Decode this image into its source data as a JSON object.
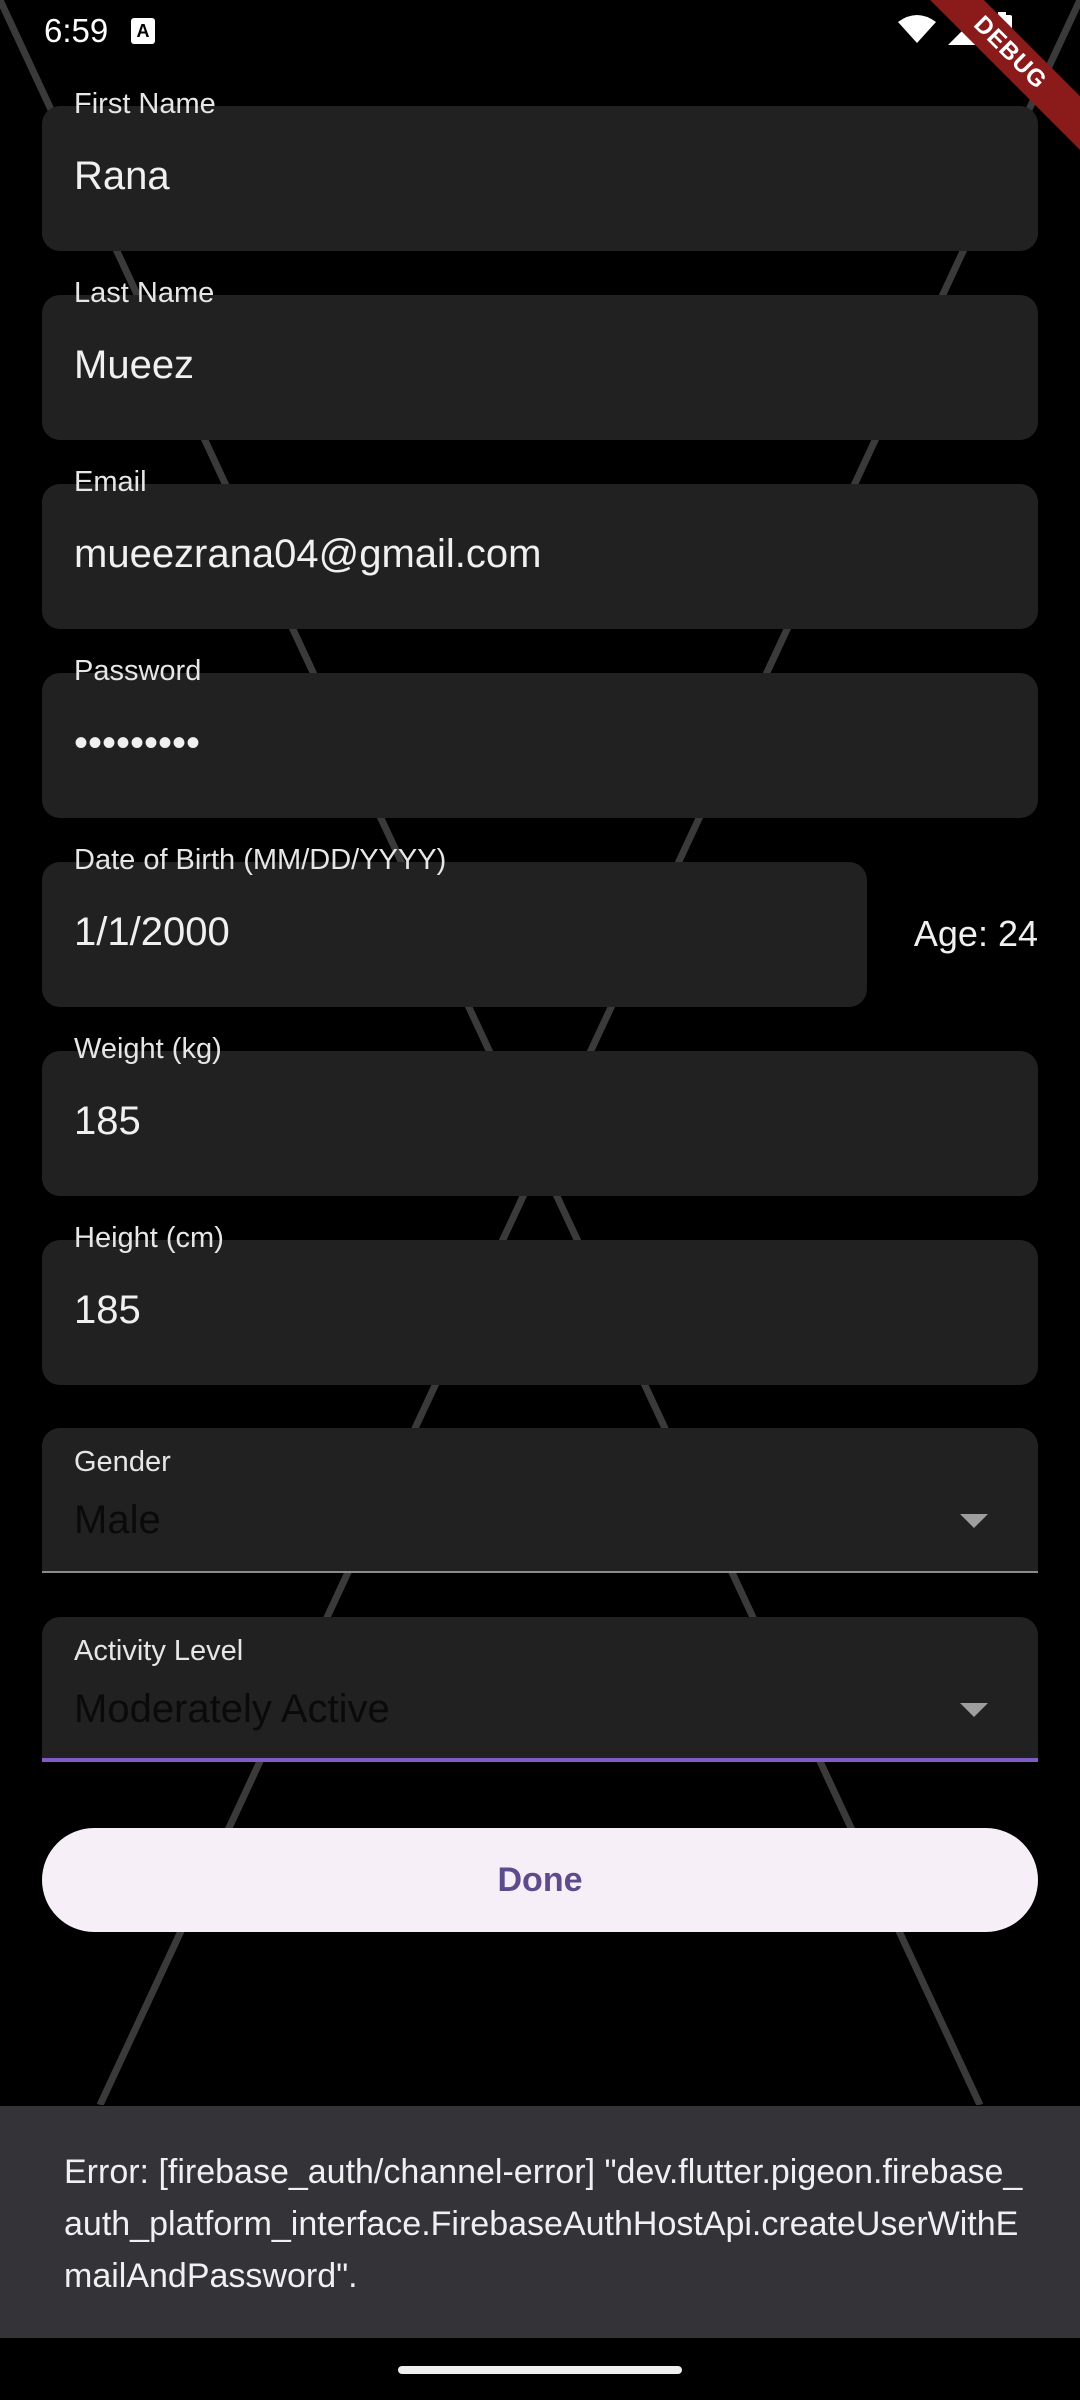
{
  "status_bar": {
    "time": "6:59",
    "notif_glyph": "A",
    "debug_label": "DEBUG"
  },
  "form": {
    "first_name": {
      "label": "First Name",
      "value": "Rana"
    },
    "last_name": {
      "label": "Last Name",
      "value": "Mueez"
    },
    "email": {
      "label": "Email",
      "value": "mueezrana04@gmail.com"
    },
    "password": {
      "label": "Password",
      "value": "•••••••••"
    },
    "dob": {
      "label": "Date of Birth (MM/DD/YYYY)",
      "value": "1/1/2000"
    },
    "age_text": "Age: 24",
    "weight": {
      "label": "Weight (kg)",
      "value": "185"
    },
    "height": {
      "label": "Height (cm)",
      "value": "185"
    },
    "gender": {
      "label": "Gender",
      "value": "Male"
    },
    "activity": {
      "label": "Activity Level",
      "value": "Moderately Active"
    },
    "done_label": "Done"
  },
  "snackbar": {
    "message": "Error: [firebase_auth/channel-error] \"dev.flutter.pigeon.firebase_auth_platform_interface.FirebaseAuthHostApi.createUserWithEmailAndPassword\"."
  },
  "colors": {
    "background": "#000000",
    "field_bg": "#212121",
    "accent": "#7e5bc6",
    "button_bg": "#f6eff7",
    "button_text": "#5e4b8b",
    "snackbar_bg": "#333338"
  }
}
